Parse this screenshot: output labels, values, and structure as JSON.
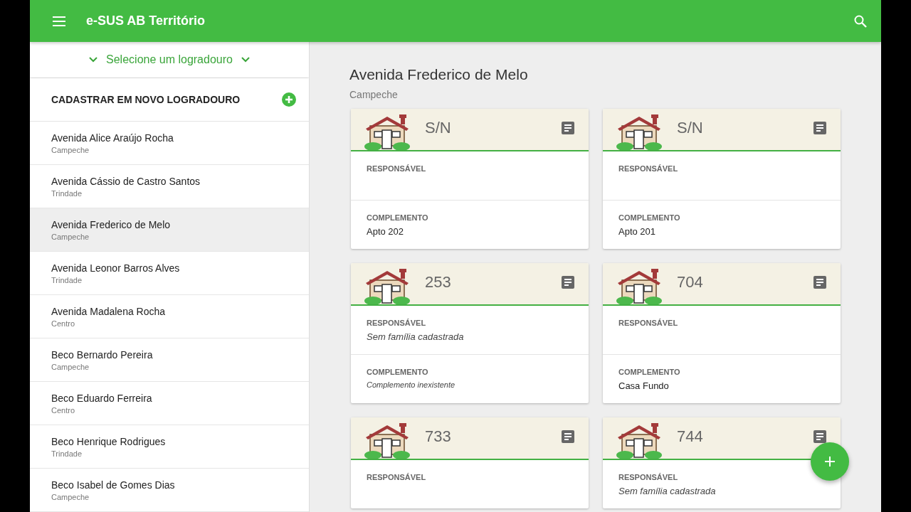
{
  "app_bar": {
    "title": "e-SUS AB Território"
  },
  "sidebar": {
    "street_selector": "Selecione um logradouro",
    "new_street": "CADASTRAR EM NOVO LOGRADOURO",
    "items": [
      {
        "name": "Avenida Alice Araújo Rocha",
        "district": "Campeche",
        "selected": false
      },
      {
        "name": "Avenida Cássio de Castro Santos",
        "district": "Trindade",
        "selected": false
      },
      {
        "name": "Avenida Frederico de Melo",
        "district": "Campeche",
        "selected": true
      },
      {
        "name": "Avenida Leonor Barros Alves",
        "district": "Trindade",
        "selected": false
      },
      {
        "name": "Avenida Madalena Rocha",
        "district": "Centro",
        "selected": false
      },
      {
        "name": "Beco Bernardo Pereira",
        "district": "Campeche",
        "selected": false
      },
      {
        "name": "Beco Eduardo Ferreira",
        "district": "Centro",
        "selected": false
      },
      {
        "name": "Beco Henrique Rodrigues",
        "district": "Trindade",
        "selected": false
      },
      {
        "name": "Beco Isabel de Gomes Dias",
        "district": "Campeche",
        "selected": false
      }
    ]
  },
  "main": {
    "title": "Avenida Frederico de Melo",
    "subtitle": "Campeche",
    "cards": [
      {
        "number": "S/N",
        "responsible_label": "RESPONSÁVEL",
        "complement_label": "COMPLEMENTO",
        "complement": {
          "text": "Apto 202",
          "kind": "value"
        }
      },
      {
        "number": "S/N",
        "responsible_label": "RESPONSÁVEL",
        "complement_label": "COMPLEMENTO",
        "complement": {
          "text": "Apto 201",
          "kind": "value"
        }
      },
      {
        "number": "253",
        "responsible_label": "RESPONSÁVEL",
        "responsible": {
          "text": "Sem família cadastrada",
          "kind": "missing"
        },
        "complement_label": "COMPLEMENTO",
        "complement": {
          "text": "Complemento inexistente",
          "kind": "missing"
        }
      },
      {
        "number": "704",
        "responsible_label": "RESPONSÁVEL",
        "complement_label": "COMPLEMENTO",
        "complement": {
          "text": "Casa Fundo",
          "kind": "value"
        }
      },
      {
        "number": "733",
        "responsible_label": "RESPONSÁVEL"
      },
      {
        "number": "744",
        "responsible_label": "RESPONSÁVEL",
        "responsible": {
          "text": "Sem família cadastrada",
          "kind": "missing"
        }
      }
    ]
  }
}
